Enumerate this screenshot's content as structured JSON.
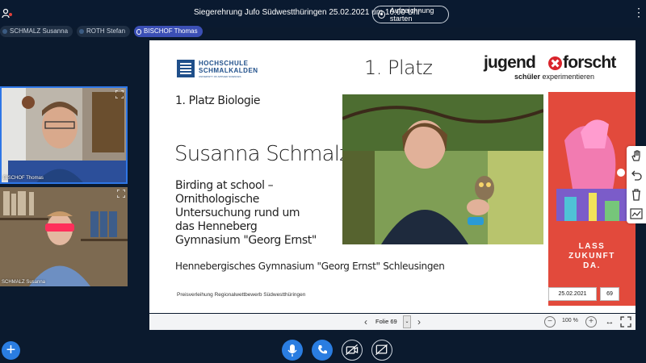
{
  "meeting": {
    "title": "Siegerehrung Jufo Südwestthüringen 25.02.2021 um 16:00 Uhr",
    "record_label": "Aufzeichnung starten"
  },
  "participants": [
    {
      "name": "SCHMALZ Susanna"
    },
    {
      "name": "ROTH Stefan"
    },
    {
      "name": "BISCHOF Thomas",
      "speaking": true
    }
  ],
  "webcams": [
    {
      "label": "BISCHOF Thomas"
    },
    {
      "label": "SCHMALZ Susanna"
    }
  ],
  "slide": {
    "hs_logo": {
      "line1": "HOCHSCHULE",
      "line2": "SCHMALKALDEN",
      "line3": "UNIVERSITY OF APPLIED SCIENCES"
    },
    "placement": "1. Platz",
    "jf_logo": {
      "part1": "jugend",
      "part2": "forscht",
      "sub_bold": "schüler",
      "sub_rest": " experimentieren"
    },
    "category": "1. Platz Biologie",
    "winner": "Susanna Schmalz",
    "project_lines": [
      "Birding at school –",
      "Ornithologische",
      "Untersuchung rund um",
      "das Henneberg",
      "Gymnasium \"Georg Ernst\""
    ],
    "school": "Hennebergisches Gymnasium \"Georg Ernst\" Schleusingen",
    "event": "Preisverleihung Regionalwettbewerb Südwestthüringen",
    "poster_lines": [
      "LASS",
      "ZUKUNFT",
      "DA."
    ],
    "date": "25.02.2021",
    "number": "69"
  },
  "presentation_bar": {
    "slide_label": "Folie 69",
    "zoom": "100 %"
  },
  "colors": {
    "background": "#0b1a2e",
    "accent_blue": "#2a7de1",
    "speaking_chip": "#3b4fb5",
    "poster_red": "#e24a3c",
    "jf_red": "#d9242b"
  }
}
